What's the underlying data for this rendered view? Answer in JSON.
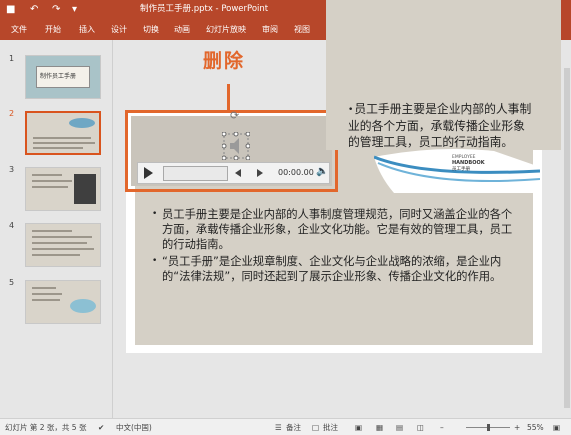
{
  "titlebar": {
    "title": "制作员工手册.pptx - PowerPoint",
    "save_icon": "save-icon",
    "undo_icon": "↶",
    "redo_icon": "↷"
  },
  "tabs": [
    "文件",
    "开始",
    "插入",
    "设计",
    "切换",
    "动画",
    "幻灯片放映",
    "审阅",
    "视图"
  ],
  "thumbnails": {
    "numbers": [
      "1",
      "2",
      "3",
      "4",
      "5"
    ],
    "slide1_title": "制作员工手册"
  },
  "annotation": {
    "delete_label": "删除"
  },
  "right_text": "员工手册主要是企业内部的人事制业的各个方面，承载传播企业形象的管理工具，员工的行动指南。",
  "right_text_lines": [
    "员工手册主要是企业内部的人事制",
    "业的各个方面，承载传播企业形象",
    "的管理工具，员工的行动指南。"
  ],
  "book": {
    "line1": "EMPLOYEE",
    "line2": "HANDBOOK",
    "line3": "员工手册"
  },
  "player": {
    "time": "00:00.00"
  },
  "bullets": [
    "员工手册主要是企业内部的人事制度管理规范，同时又涵盖企业的各个方面，承载传播企业形象，企业文化功能。它是有效的管理工具，员工的行动指南。",
    "“员工手册”是企业规章制度、企业文化与企业战略的浓缩，是企业内的“法律法规”，同时还起到了展示企业形象、传播企业文化的作用。"
  ],
  "status": {
    "slide_info": "幻灯片 第 2 张，共 5 张",
    "language": "中文(中国)",
    "notes": "备注",
    "comments": "批注",
    "zoom": "55%"
  },
  "colors": {
    "accent": "#b7472a",
    "annotation": "#e2672c",
    "slide_bg": "#d5d0c6"
  }
}
